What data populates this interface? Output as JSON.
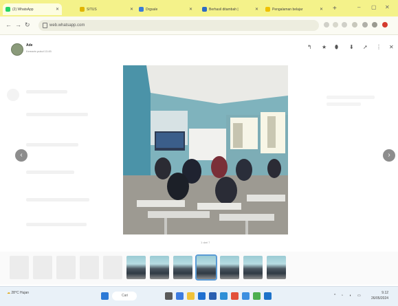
{
  "browser": {
    "tabs": [
      {
        "label": "(2) WhatsApp",
        "active": true
      },
      {
        "label": "SITUS",
        "active": false
      },
      {
        "label": "Drgsale",
        "active": false
      },
      {
        "label": "Berhasil ditambah |",
        "active": false
      },
      {
        "label": "Pengalaman belajar",
        "active": false
      }
    ],
    "new_tab": "+",
    "window_controls": [
      "–",
      "▢",
      "✕"
    ],
    "address": "web.whatsapp.com"
  },
  "viewer": {
    "sender_name": "Ade",
    "sender_time": "Kemarin pukul 13.45",
    "caption": "1 dari 7",
    "prev": "‹",
    "next": "›"
  },
  "taskbar": {
    "weather_temp": "28°C",
    "weather_desc": "Hujan",
    "search_label": "Cari",
    "time": "9.12",
    "date": "26/05/2024"
  },
  "colors": {
    "tabstrip": "#f4f28a",
    "accent": "#5a9bd5",
    "taskbar": "#e9f1f8"
  }
}
